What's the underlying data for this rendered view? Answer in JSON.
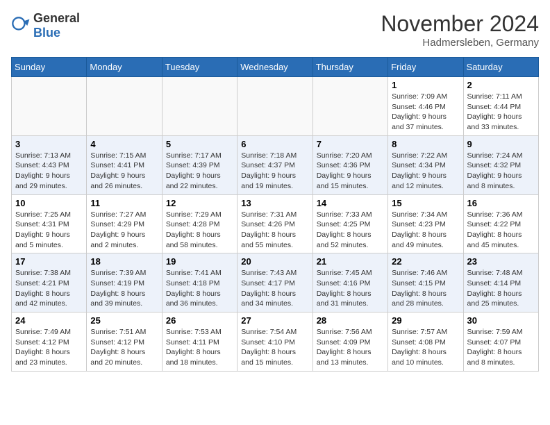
{
  "header": {
    "logo_general": "General",
    "logo_blue": "Blue",
    "month_year": "November 2024",
    "location": "Hadmersleben, Germany"
  },
  "days_of_week": [
    "Sunday",
    "Monday",
    "Tuesday",
    "Wednesday",
    "Thursday",
    "Friday",
    "Saturday"
  ],
  "weeks": [
    [
      {
        "day": "",
        "info": ""
      },
      {
        "day": "",
        "info": ""
      },
      {
        "day": "",
        "info": ""
      },
      {
        "day": "",
        "info": ""
      },
      {
        "day": "",
        "info": ""
      },
      {
        "day": "1",
        "info": "Sunrise: 7:09 AM\nSunset: 4:46 PM\nDaylight: 9 hours and 37 minutes."
      },
      {
        "day": "2",
        "info": "Sunrise: 7:11 AM\nSunset: 4:44 PM\nDaylight: 9 hours and 33 minutes."
      }
    ],
    [
      {
        "day": "3",
        "info": "Sunrise: 7:13 AM\nSunset: 4:43 PM\nDaylight: 9 hours and 29 minutes."
      },
      {
        "day": "4",
        "info": "Sunrise: 7:15 AM\nSunset: 4:41 PM\nDaylight: 9 hours and 26 minutes."
      },
      {
        "day": "5",
        "info": "Sunrise: 7:17 AM\nSunset: 4:39 PM\nDaylight: 9 hours and 22 minutes."
      },
      {
        "day": "6",
        "info": "Sunrise: 7:18 AM\nSunset: 4:37 PM\nDaylight: 9 hours and 19 minutes."
      },
      {
        "day": "7",
        "info": "Sunrise: 7:20 AM\nSunset: 4:36 PM\nDaylight: 9 hours and 15 minutes."
      },
      {
        "day": "8",
        "info": "Sunrise: 7:22 AM\nSunset: 4:34 PM\nDaylight: 9 hours and 12 minutes."
      },
      {
        "day": "9",
        "info": "Sunrise: 7:24 AM\nSunset: 4:32 PM\nDaylight: 9 hours and 8 minutes."
      }
    ],
    [
      {
        "day": "10",
        "info": "Sunrise: 7:25 AM\nSunset: 4:31 PM\nDaylight: 9 hours and 5 minutes."
      },
      {
        "day": "11",
        "info": "Sunrise: 7:27 AM\nSunset: 4:29 PM\nDaylight: 9 hours and 2 minutes."
      },
      {
        "day": "12",
        "info": "Sunrise: 7:29 AM\nSunset: 4:28 PM\nDaylight: 8 hours and 58 minutes."
      },
      {
        "day": "13",
        "info": "Sunrise: 7:31 AM\nSunset: 4:26 PM\nDaylight: 8 hours and 55 minutes."
      },
      {
        "day": "14",
        "info": "Sunrise: 7:33 AM\nSunset: 4:25 PM\nDaylight: 8 hours and 52 minutes."
      },
      {
        "day": "15",
        "info": "Sunrise: 7:34 AM\nSunset: 4:23 PM\nDaylight: 8 hours and 49 minutes."
      },
      {
        "day": "16",
        "info": "Sunrise: 7:36 AM\nSunset: 4:22 PM\nDaylight: 8 hours and 45 minutes."
      }
    ],
    [
      {
        "day": "17",
        "info": "Sunrise: 7:38 AM\nSunset: 4:21 PM\nDaylight: 8 hours and 42 minutes."
      },
      {
        "day": "18",
        "info": "Sunrise: 7:39 AM\nSunset: 4:19 PM\nDaylight: 8 hours and 39 minutes."
      },
      {
        "day": "19",
        "info": "Sunrise: 7:41 AM\nSunset: 4:18 PM\nDaylight: 8 hours and 36 minutes."
      },
      {
        "day": "20",
        "info": "Sunrise: 7:43 AM\nSunset: 4:17 PM\nDaylight: 8 hours and 34 minutes."
      },
      {
        "day": "21",
        "info": "Sunrise: 7:45 AM\nSunset: 4:16 PM\nDaylight: 8 hours and 31 minutes."
      },
      {
        "day": "22",
        "info": "Sunrise: 7:46 AM\nSunset: 4:15 PM\nDaylight: 8 hours and 28 minutes."
      },
      {
        "day": "23",
        "info": "Sunrise: 7:48 AM\nSunset: 4:14 PM\nDaylight: 8 hours and 25 minutes."
      }
    ],
    [
      {
        "day": "24",
        "info": "Sunrise: 7:49 AM\nSunset: 4:12 PM\nDaylight: 8 hours and 23 minutes."
      },
      {
        "day": "25",
        "info": "Sunrise: 7:51 AM\nSunset: 4:12 PM\nDaylight: 8 hours and 20 minutes."
      },
      {
        "day": "26",
        "info": "Sunrise: 7:53 AM\nSunset: 4:11 PM\nDaylight: 8 hours and 18 minutes."
      },
      {
        "day": "27",
        "info": "Sunrise: 7:54 AM\nSunset: 4:10 PM\nDaylight: 8 hours and 15 minutes."
      },
      {
        "day": "28",
        "info": "Sunrise: 7:56 AM\nSunset: 4:09 PM\nDaylight: 8 hours and 13 minutes."
      },
      {
        "day": "29",
        "info": "Sunrise: 7:57 AM\nSunset: 4:08 PM\nDaylight: 8 hours and 10 minutes."
      },
      {
        "day": "30",
        "info": "Sunrise: 7:59 AM\nSunset: 4:07 PM\nDaylight: 8 hours and 8 minutes."
      }
    ]
  ]
}
